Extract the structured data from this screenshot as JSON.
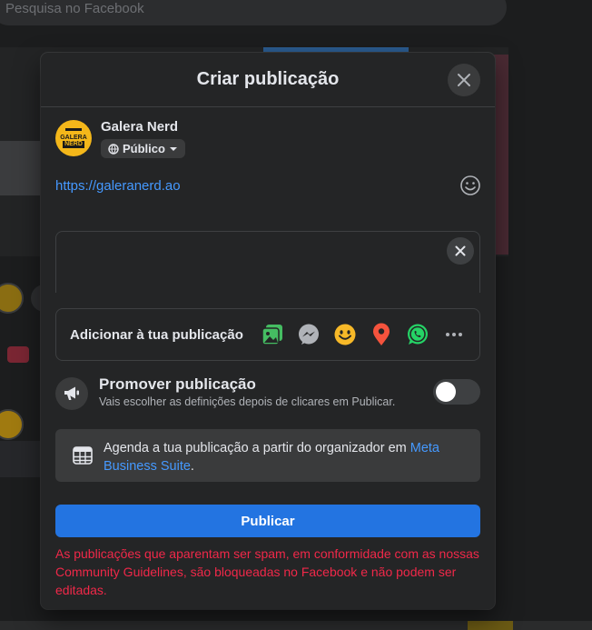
{
  "background": {
    "search_placeholder": "Pesquisa no Facebook"
  },
  "modal": {
    "title": "Criar publicação",
    "author": {
      "name": "Galera Nerd",
      "audience": "Público",
      "avatar_text_top": "GALERA",
      "avatar_text_bottom": "NERD"
    },
    "post_text": "https://galeranerd.ao",
    "add_bar": {
      "label": "Adicionar à tua publicação",
      "icons": [
        "photo-video-icon",
        "messenger-icon",
        "feeling-emoji-icon",
        "location-pin-icon",
        "whatsapp-icon",
        "more-icon"
      ]
    },
    "promote": {
      "title": "Promover publicação",
      "description": "Vais escolher as definições depois de clicares em Publicar.",
      "enabled": false
    },
    "schedule": {
      "text": "Agenda a tua publicação a partir do organizador em ",
      "link": "Meta Business Suite",
      "suffix": "."
    },
    "publish_label": "Publicar",
    "warning": "As publicações que aparentam ser spam, em conformidade com as nossas Community Guidelines, são bloqueadas no Facebook e não podem ser editadas."
  },
  "colors": {
    "accent": "#2374e1",
    "link": "#4599ff",
    "warning": "#f02849",
    "modal_bg": "#242526"
  }
}
